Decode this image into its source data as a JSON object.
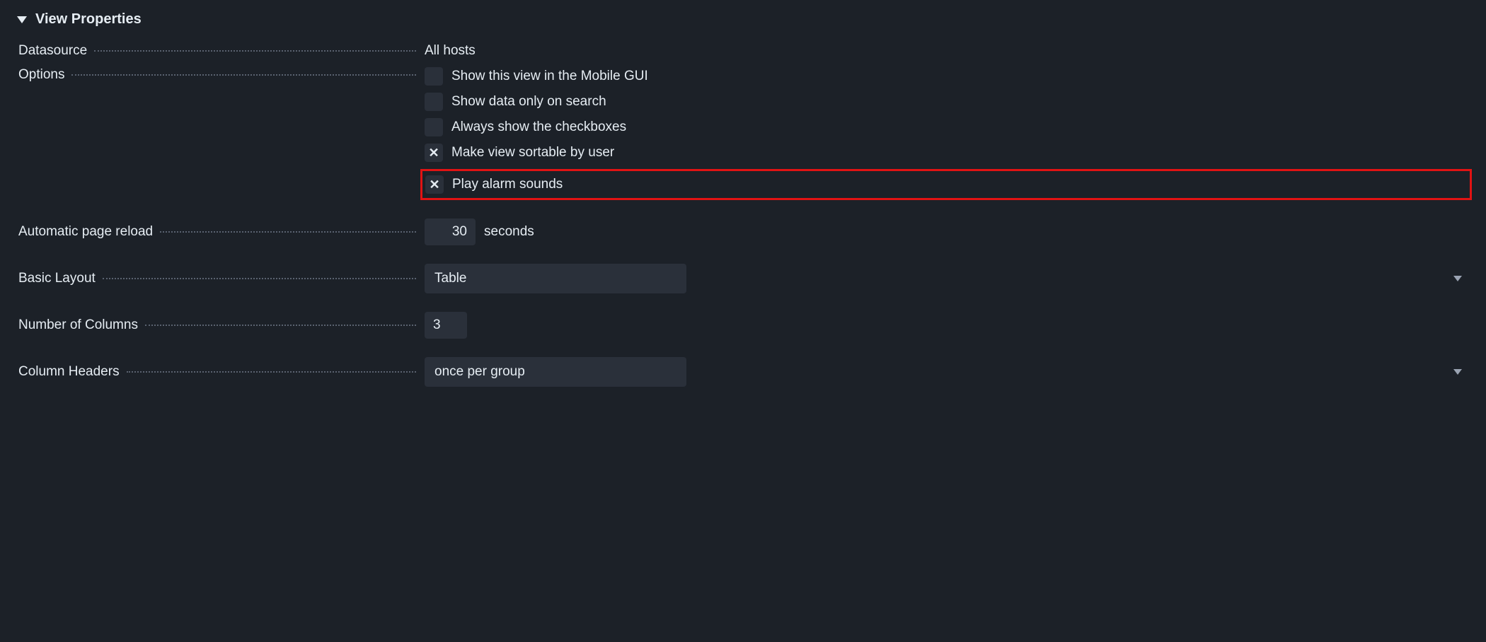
{
  "panel": {
    "title": "View Properties"
  },
  "labels": {
    "datasource": "Datasource",
    "options": "Options",
    "auto_reload": "Automatic page reload",
    "basic_layout": "Basic Layout",
    "num_columns": "Number of Columns",
    "col_headers": "Column Headers"
  },
  "values": {
    "datasource": "All hosts",
    "reload_seconds": "30",
    "reload_suffix": "seconds",
    "basic_layout": "Table",
    "num_columns": "3",
    "col_headers": "once per group"
  },
  "options": {
    "mobile": {
      "label": "Show this view in the Mobile GUI",
      "checked": false
    },
    "search_only": {
      "label": "Show data only on search",
      "checked": false
    },
    "checkboxes": {
      "label": "Always show the checkboxes",
      "checked": false
    },
    "sortable": {
      "label": "Make view sortable by user",
      "checked": true
    },
    "alarm": {
      "label": "Play alarm sounds",
      "checked": true
    }
  }
}
